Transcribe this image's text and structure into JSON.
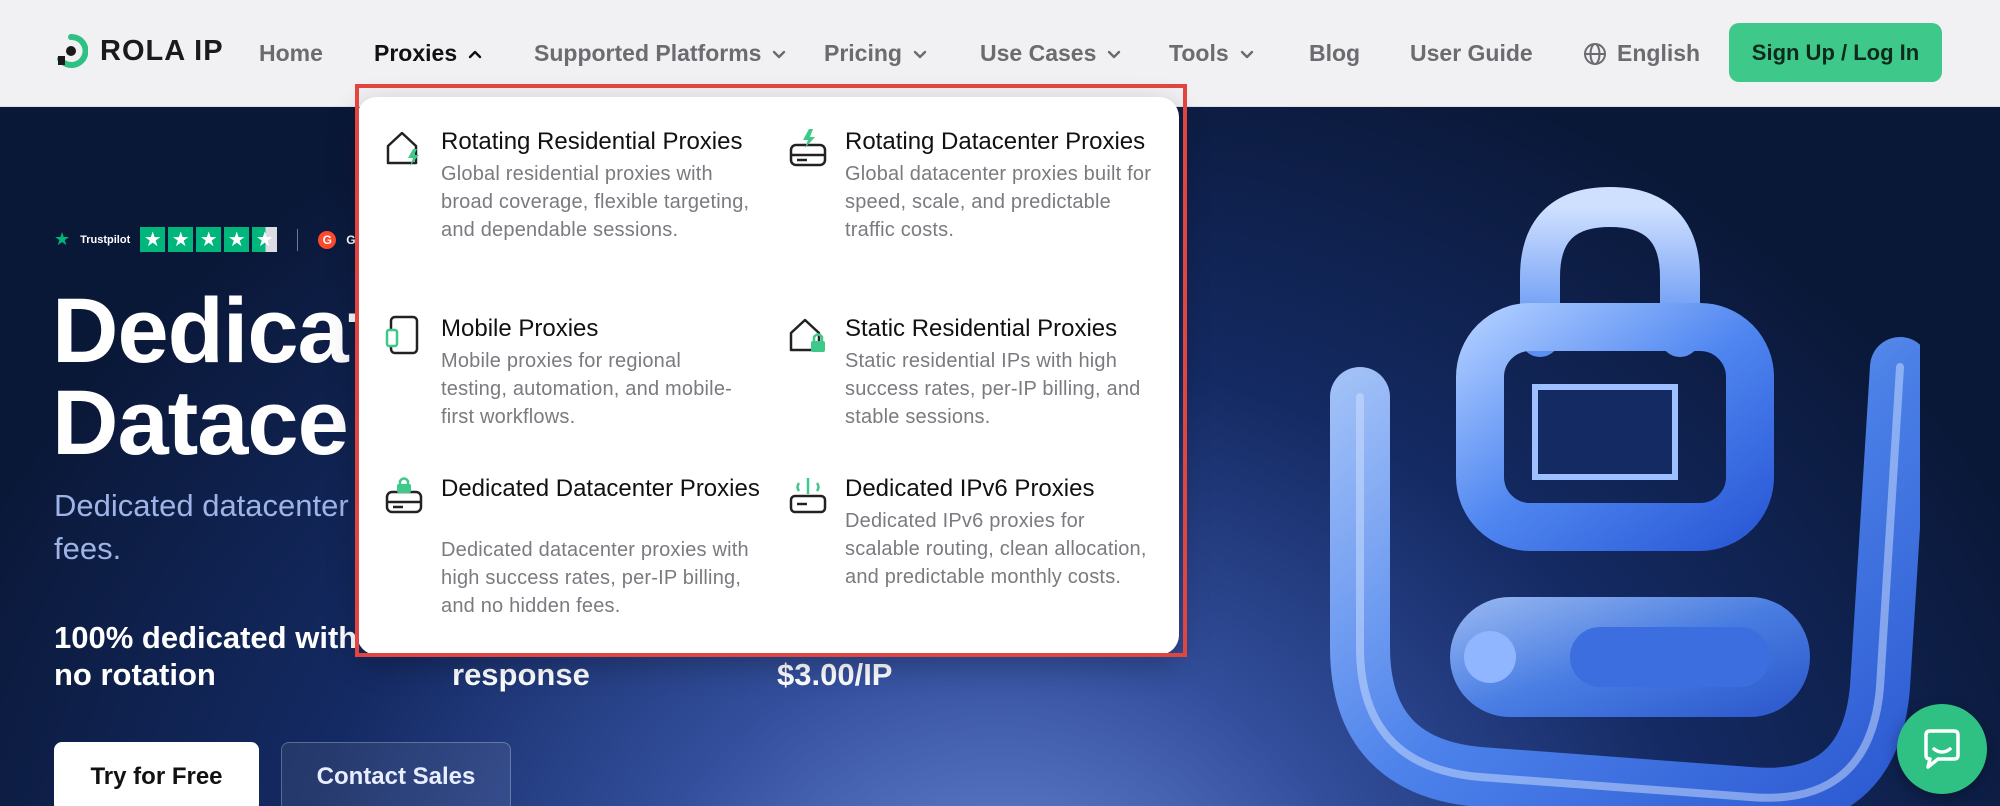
{
  "nav": {
    "logo_text": "ROLA IP",
    "items": [
      {
        "label": "Home"
      },
      {
        "label": "Proxies"
      },
      {
        "label": "Supported Platforms"
      },
      {
        "label": "Pricing"
      },
      {
        "label": "Use Cases"
      },
      {
        "label": "Tools"
      },
      {
        "label": "Blog"
      },
      {
        "label": "User Guide"
      }
    ],
    "language": "English",
    "cta": "Sign Up / Log In"
  },
  "hero": {
    "ratings": {
      "trustpilot": "Trustpilot",
      "g2": "G2"
    },
    "title_line1": "Dedicat",
    "title_line2": "Datace",
    "subtitle": "Dedicated datacenter p no hidden fees.",
    "features": [
      {
        "line1": "100% dedicated with",
        "line2": "no rotation"
      },
      {
        "line1": "",
        "line2": "response"
      },
      {
        "line1": "",
        "line2": "$3.00/IP"
      }
    ],
    "try_button": "Try for Free",
    "contact_button": "Contact Sales"
  },
  "dropdown": {
    "items": [
      {
        "title": "Rotating Residential Proxies",
        "desc": "Global residential proxies with broad coverage, flexible targeting, and dependable sessions.",
        "icon": "house-bolt-icon"
      },
      {
        "title": "Rotating Datacenter Proxies",
        "desc": "Global datacenter proxies built for speed, scale, and predictable traffic costs.",
        "icon": "server-bolt-icon"
      },
      {
        "title": "Mobile Proxies",
        "desc": "Mobile proxies for regional testing, automation, and mobile-first workflows.",
        "icon": "mobile-icon"
      },
      {
        "title": "Static Residential Proxies",
        "desc": "Static residential IPs with high success rates, per-IP billing, and stable sessions.",
        "icon": "house-lock-icon"
      },
      {
        "title": "Dedicated Datacenter Proxies",
        "desc": "Dedicated datacenter proxies with high success rates, per-IP billing, and no hidden fees.",
        "icon": "server-lock-icon"
      },
      {
        "title": "Dedicated IPv6 Proxies",
        "desc": "Dedicated IPv6 proxies for scalable routing, clean allocation, and predictable monthly costs.",
        "icon": "router-icon"
      }
    ]
  },
  "colors": {
    "accent": "#3ec98a",
    "highlight": "#e0453f",
    "hero_bg": "#0b1a3a"
  }
}
